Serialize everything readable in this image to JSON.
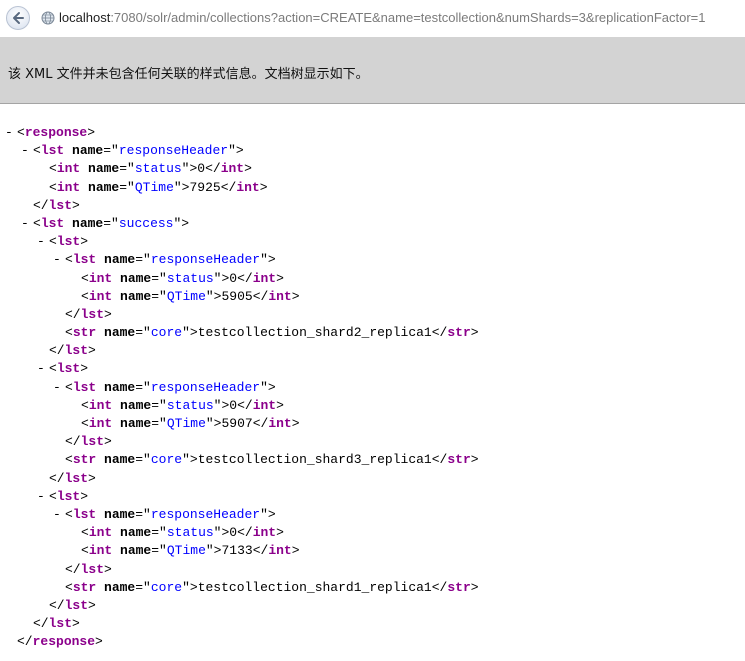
{
  "browser": {
    "url_host": "localhost",
    "url_rest": ":7080/solr/admin/collections?action=CREATE&name=testcollection&numShards=3&replicationFactor=1"
  },
  "info_bar": {
    "message": "该 XML 文件并未包含任何关联的样式信息。文档树显示如下。"
  },
  "xml_lines": [
    {
      "indent": 0,
      "toggle": "-",
      "parts": [
        [
          "p",
          "<"
        ],
        [
          "tag",
          "response"
        ],
        [
          "p",
          ">"
        ]
      ]
    },
    {
      "indent": 1,
      "toggle": "-",
      "parts": [
        [
          "p",
          "<"
        ],
        [
          "tag",
          "lst"
        ],
        [
          "p",
          " "
        ],
        [
          "an",
          "name"
        ],
        [
          "p",
          "=\""
        ],
        [
          "av",
          "responseHeader"
        ],
        [
          "p",
          "\">"
        ]
      ]
    },
    {
      "indent": 2,
      "toggle": "",
      "parts": [
        [
          "p",
          "<"
        ],
        [
          "tag",
          "int"
        ],
        [
          "p",
          " "
        ],
        [
          "an",
          "name"
        ],
        [
          "p",
          "=\""
        ],
        [
          "av",
          "status"
        ],
        [
          "p",
          "\">"
        ],
        [
          "tx",
          "0"
        ],
        [
          "p",
          "</"
        ],
        [
          "tag",
          "int"
        ],
        [
          "p",
          ">"
        ]
      ]
    },
    {
      "indent": 2,
      "toggle": "",
      "parts": [
        [
          "p",
          "<"
        ],
        [
          "tag",
          "int"
        ],
        [
          "p",
          " "
        ],
        [
          "an",
          "name"
        ],
        [
          "p",
          "=\""
        ],
        [
          "av",
          "QTime"
        ],
        [
          "p",
          "\">"
        ],
        [
          "tx",
          "7925"
        ],
        [
          "p",
          "</"
        ],
        [
          "tag",
          "int"
        ],
        [
          "p",
          ">"
        ]
      ]
    },
    {
      "indent": 1,
      "toggle": "",
      "parts": [
        [
          "p",
          "</"
        ],
        [
          "tag",
          "lst"
        ],
        [
          "p",
          ">"
        ]
      ]
    },
    {
      "indent": 1,
      "toggle": "-",
      "parts": [
        [
          "p",
          "<"
        ],
        [
          "tag",
          "lst"
        ],
        [
          "p",
          " "
        ],
        [
          "an",
          "name"
        ],
        [
          "p",
          "=\""
        ],
        [
          "av",
          "success"
        ],
        [
          "p",
          "\">"
        ]
      ]
    },
    {
      "indent": 2,
      "toggle": "-",
      "parts": [
        [
          "p",
          "<"
        ],
        [
          "tag",
          "lst"
        ],
        [
          "p",
          ">"
        ]
      ]
    },
    {
      "indent": 3,
      "toggle": "-",
      "parts": [
        [
          "p",
          "<"
        ],
        [
          "tag",
          "lst"
        ],
        [
          "p",
          " "
        ],
        [
          "an",
          "name"
        ],
        [
          "p",
          "=\""
        ],
        [
          "av",
          "responseHeader"
        ],
        [
          "p",
          "\">"
        ]
      ]
    },
    {
      "indent": 4,
      "toggle": "",
      "parts": [
        [
          "p",
          "<"
        ],
        [
          "tag",
          "int"
        ],
        [
          "p",
          " "
        ],
        [
          "an",
          "name"
        ],
        [
          "p",
          "=\""
        ],
        [
          "av",
          "status"
        ],
        [
          "p",
          "\">"
        ],
        [
          "tx",
          "0"
        ],
        [
          "p",
          "</"
        ],
        [
          "tag",
          "int"
        ],
        [
          "p",
          ">"
        ]
      ]
    },
    {
      "indent": 4,
      "toggle": "",
      "parts": [
        [
          "p",
          "<"
        ],
        [
          "tag",
          "int"
        ],
        [
          "p",
          " "
        ],
        [
          "an",
          "name"
        ],
        [
          "p",
          "=\""
        ],
        [
          "av",
          "QTime"
        ],
        [
          "p",
          "\">"
        ],
        [
          "tx",
          "5905"
        ],
        [
          "p",
          "</"
        ],
        [
          "tag",
          "int"
        ],
        [
          "p",
          ">"
        ]
      ]
    },
    {
      "indent": 3,
      "toggle": "",
      "parts": [
        [
          "p",
          "</"
        ],
        [
          "tag",
          "lst"
        ],
        [
          "p",
          ">"
        ]
      ]
    },
    {
      "indent": 3,
      "toggle": "",
      "parts": [
        [
          "p",
          "<"
        ],
        [
          "tag",
          "str"
        ],
        [
          "p",
          " "
        ],
        [
          "an",
          "name"
        ],
        [
          "p",
          "=\""
        ],
        [
          "av",
          "core"
        ],
        [
          "p",
          "\">"
        ],
        [
          "tx",
          "testcollection_shard2_replica1"
        ],
        [
          "p",
          "</"
        ],
        [
          "tag",
          "str"
        ],
        [
          "p",
          ">"
        ]
      ]
    },
    {
      "indent": 2,
      "toggle": "",
      "parts": [
        [
          "p",
          "</"
        ],
        [
          "tag",
          "lst"
        ],
        [
          "p",
          ">"
        ]
      ]
    },
    {
      "indent": 2,
      "toggle": "-",
      "parts": [
        [
          "p",
          "<"
        ],
        [
          "tag",
          "lst"
        ],
        [
          "p",
          ">"
        ]
      ]
    },
    {
      "indent": 3,
      "toggle": "-",
      "parts": [
        [
          "p",
          "<"
        ],
        [
          "tag",
          "lst"
        ],
        [
          "p",
          " "
        ],
        [
          "an",
          "name"
        ],
        [
          "p",
          "=\""
        ],
        [
          "av",
          "responseHeader"
        ],
        [
          "p",
          "\">"
        ]
      ]
    },
    {
      "indent": 4,
      "toggle": "",
      "parts": [
        [
          "p",
          "<"
        ],
        [
          "tag",
          "int"
        ],
        [
          "p",
          " "
        ],
        [
          "an",
          "name"
        ],
        [
          "p",
          "=\""
        ],
        [
          "av",
          "status"
        ],
        [
          "p",
          "\">"
        ],
        [
          "tx",
          "0"
        ],
        [
          "p",
          "</"
        ],
        [
          "tag",
          "int"
        ],
        [
          "p",
          ">"
        ]
      ]
    },
    {
      "indent": 4,
      "toggle": "",
      "parts": [
        [
          "p",
          "<"
        ],
        [
          "tag",
          "int"
        ],
        [
          "p",
          " "
        ],
        [
          "an",
          "name"
        ],
        [
          "p",
          "=\""
        ],
        [
          "av",
          "QTime"
        ],
        [
          "p",
          "\">"
        ],
        [
          "tx",
          "5907"
        ],
        [
          "p",
          "</"
        ],
        [
          "tag",
          "int"
        ],
        [
          "p",
          ">"
        ]
      ]
    },
    {
      "indent": 3,
      "toggle": "",
      "parts": [
        [
          "p",
          "</"
        ],
        [
          "tag",
          "lst"
        ],
        [
          "p",
          ">"
        ]
      ]
    },
    {
      "indent": 3,
      "toggle": "",
      "parts": [
        [
          "p",
          "<"
        ],
        [
          "tag",
          "str"
        ],
        [
          "p",
          " "
        ],
        [
          "an",
          "name"
        ],
        [
          "p",
          "=\""
        ],
        [
          "av",
          "core"
        ],
        [
          "p",
          "\">"
        ],
        [
          "tx",
          "testcollection_shard3_replica1"
        ],
        [
          "p",
          "</"
        ],
        [
          "tag",
          "str"
        ],
        [
          "p",
          ">"
        ]
      ]
    },
    {
      "indent": 2,
      "toggle": "",
      "parts": [
        [
          "p",
          "</"
        ],
        [
          "tag",
          "lst"
        ],
        [
          "p",
          ">"
        ]
      ]
    },
    {
      "indent": 2,
      "toggle": "-",
      "parts": [
        [
          "p",
          "<"
        ],
        [
          "tag",
          "lst"
        ],
        [
          "p",
          ">"
        ]
      ]
    },
    {
      "indent": 3,
      "toggle": "-",
      "parts": [
        [
          "p",
          "<"
        ],
        [
          "tag",
          "lst"
        ],
        [
          "p",
          " "
        ],
        [
          "an",
          "name"
        ],
        [
          "p",
          "=\""
        ],
        [
          "av",
          "responseHeader"
        ],
        [
          "p",
          "\">"
        ]
      ]
    },
    {
      "indent": 4,
      "toggle": "",
      "parts": [
        [
          "p",
          "<"
        ],
        [
          "tag",
          "int"
        ],
        [
          "p",
          " "
        ],
        [
          "an",
          "name"
        ],
        [
          "p",
          "=\""
        ],
        [
          "av",
          "status"
        ],
        [
          "p",
          "\">"
        ],
        [
          "tx",
          "0"
        ],
        [
          "p",
          "</"
        ],
        [
          "tag",
          "int"
        ],
        [
          "p",
          ">"
        ]
      ]
    },
    {
      "indent": 4,
      "toggle": "",
      "parts": [
        [
          "p",
          "<"
        ],
        [
          "tag",
          "int"
        ],
        [
          "p",
          " "
        ],
        [
          "an",
          "name"
        ],
        [
          "p",
          "=\""
        ],
        [
          "av",
          "QTime"
        ],
        [
          "p",
          "\">"
        ],
        [
          "tx",
          "7133"
        ],
        [
          "p",
          "</"
        ],
        [
          "tag",
          "int"
        ],
        [
          "p",
          ">"
        ]
      ]
    },
    {
      "indent": 3,
      "toggle": "",
      "parts": [
        [
          "p",
          "</"
        ],
        [
          "tag",
          "lst"
        ],
        [
          "p",
          ">"
        ]
      ]
    },
    {
      "indent": 3,
      "toggle": "",
      "parts": [
        [
          "p",
          "<"
        ],
        [
          "tag",
          "str"
        ],
        [
          "p",
          " "
        ],
        [
          "an",
          "name"
        ],
        [
          "p",
          "=\""
        ],
        [
          "av",
          "core"
        ],
        [
          "p",
          "\">"
        ],
        [
          "tx",
          "testcollection_shard1_replica1"
        ],
        [
          "p",
          "</"
        ],
        [
          "tag",
          "str"
        ],
        [
          "p",
          ">"
        ]
      ]
    },
    {
      "indent": 2,
      "toggle": "",
      "parts": [
        [
          "p",
          "</"
        ],
        [
          "tag",
          "lst"
        ],
        [
          "p",
          ">"
        ]
      ]
    },
    {
      "indent": 1,
      "toggle": "",
      "parts": [
        [
          "p",
          "</"
        ],
        [
          "tag",
          "lst"
        ],
        [
          "p",
          ">"
        ]
      ]
    },
    {
      "indent": 0,
      "toggle": "",
      "parts": [
        [
          "p",
          "</"
        ],
        [
          "tag",
          "response"
        ],
        [
          "p",
          ">"
        ]
      ]
    }
  ]
}
